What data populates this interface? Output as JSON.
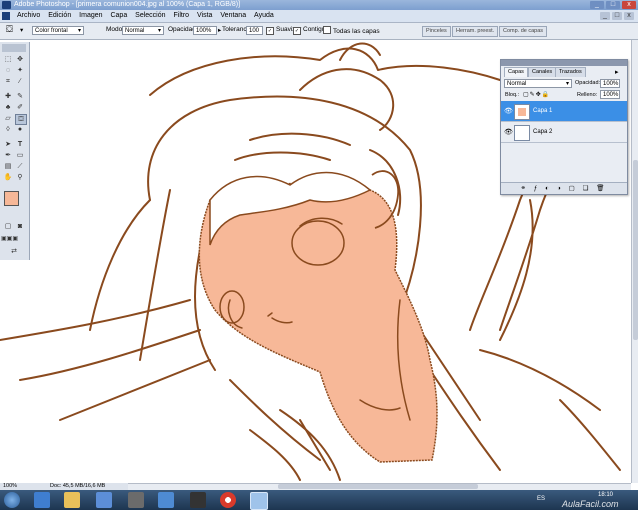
{
  "window": {
    "title": "Adobe Photoshop - [primera comunion004.jpg al 100% (Capa 1, RGB/8)]",
    "buttons": [
      "_",
      "□",
      "x"
    ]
  },
  "menu": [
    "Archivo",
    "Edición",
    "Imagen",
    "Capa",
    "Selección",
    "Filtro",
    "Vista",
    "Ventana",
    "Ayuda"
  ],
  "options_bar": {
    "fill_source": "Color frontal",
    "mode_label": "Modo:",
    "mode_value": "Normal",
    "opacity_label": "Opacidad:",
    "opacity_value": "100%",
    "tolerance_label": "Tolerancia:",
    "tolerance_value": "100",
    "antialias_label": "Suavizar",
    "contiguous_label": "Contiguo",
    "all_layers_label": "Todas las capas",
    "antialias_checked": true,
    "contiguous_checked": true,
    "all_layers_checked": false
  },
  "workspace_tabs": [
    "Pinceles",
    "Herram. preest.",
    "Comp. de capas"
  ],
  "layers_panel": {
    "tabs": [
      "Capas",
      "Canales",
      "Trazados"
    ],
    "blend_mode": "Normal",
    "opacity_label": "Opacidad:",
    "opacity_value": "100%",
    "lock_label": "Bloq.:",
    "fill_label": "Relleno:",
    "fill_value": "100%",
    "layers": [
      {
        "name": "Capa 1",
        "selected": true
      },
      {
        "name": "Capa 2",
        "selected": false
      }
    ]
  },
  "status_bar": {
    "zoom": "100%",
    "doc_info": "Doc: 45,5 MB/16,6 MB"
  },
  "taskbar": {
    "language": "ES",
    "time": "18:10",
    "watermark": "AulaFacil.com"
  },
  "colors": {
    "line_art": "#8a4a1e",
    "fill_skin": "#f7b898",
    "selected_layer": "#3b8fe6",
    "foreground_swatch": "#f7b898"
  }
}
